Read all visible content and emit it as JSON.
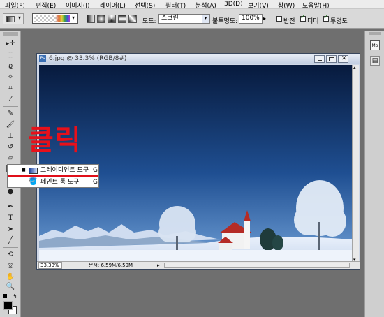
{
  "menu": {
    "items": [
      "파일(F)",
      "편집(E)",
      "이미지(I)",
      "레이어(L)",
      "선택(S)",
      "필터(T)",
      "분석(A)",
      "3D(D)",
      "보기(V)",
      "창(W)",
      "도움말(H)"
    ]
  },
  "options": {
    "mode_label": "모드:",
    "mode_value": "스크린",
    "opacity_label": "불투명도:",
    "opacity_value": "100%",
    "reverse_label": "반전",
    "dither_label": "디더",
    "transparency_label": "투명도",
    "reverse_checked": false,
    "dither_checked": true,
    "transparency_checked": true
  },
  "document": {
    "title": "6.jpg @ 33.3% (RGB/8#)",
    "zoom": "33.33%",
    "doc_info": "문서: 6.59M/6.59M"
  },
  "flyout": {
    "items": [
      {
        "label": "그레이디언트 도구",
        "shortcut": "G",
        "selected": true
      },
      {
        "label": "페인트 통 도구",
        "shortcut": "G",
        "selected": false
      }
    ]
  },
  "annotation": {
    "text": "클릭",
    "color": "#e8101a"
  },
  "icons": {
    "move": "move-icon",
    "marquee": "marquee-icon",
    "lasso": "lasso-icon",
    "magic_wand": "magic-wand-icon",
    "crop": "crop-icon",
    "eyedropper": "eyedropper-icon",
    "healing": "healing-brush-icon",
    "brush": "brush-icon",
    "stamp": "clone-stamp-icon",
    "history_brush": "history-brush-icon",
    "eraser": "eraser-icon",
    "gradient": "gradient-icon",
    "blur": "blur-icon",
    "dodge": "dodge-icon",
    "pen": "pen-icon",
    "type": "type-icon",
    "path_select": "path-selection-icon",
    "shape": "line-shape-icon",
    "3d_rotate": "3d-rotate-icon",
    "3d_orbit": "3d-orbit-icon",
    "hand": "hand-icon",
    "zoom": "zoom-icon"
  }
}
